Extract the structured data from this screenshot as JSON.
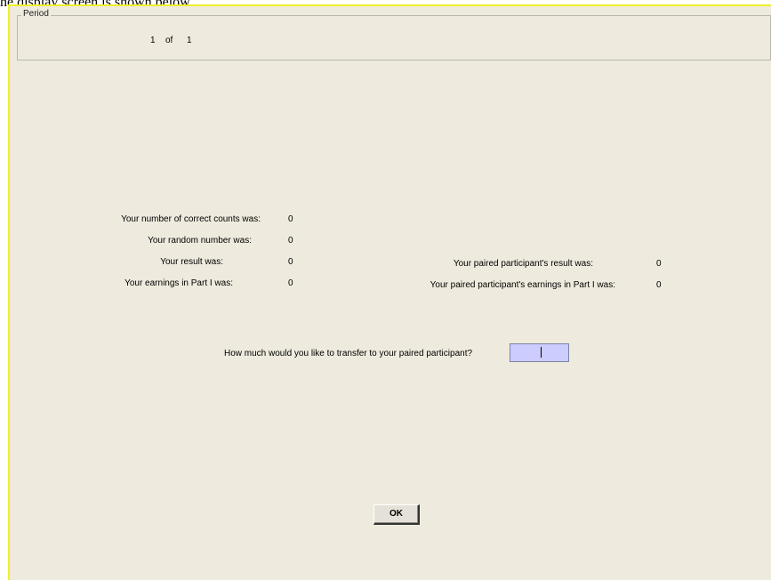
{
  "caption": "he display screen is shown below.",
  "period": {
    "legend": "Period",
    "current": "1",
    "of_label": "of",
    "total": "1"
  },
  "left_results": [
    {
      "label": "Your number of correct counts was:",
      "value": "0"
    },
    {
      "label": "Your random number was:",
      "value": "0"
    },
    {
      "label": "Your result was:",
      "value": "0"
    },
    {
      "label": "Your earnings in Part I was:",
      "value": "0"
    }
  ],
  "right_results": [
    {
      "label": "Your paired participant's result was:",
      "value": "0"
    },
    {
      "label": "Your paired participant's earnings in Part I was:",
      "value": "0"
    }
  ],
  "transfer": {
    "question": "How much would you like to transfer to your paired participant?",
    "value": ""
  },
  "ok_button_label": "OK",
  "colors": {
    "window_bg": "#eeeadd",
    "window_border": "#f0ef2a",
    "input_bg": "#ccccff"
  }
}
